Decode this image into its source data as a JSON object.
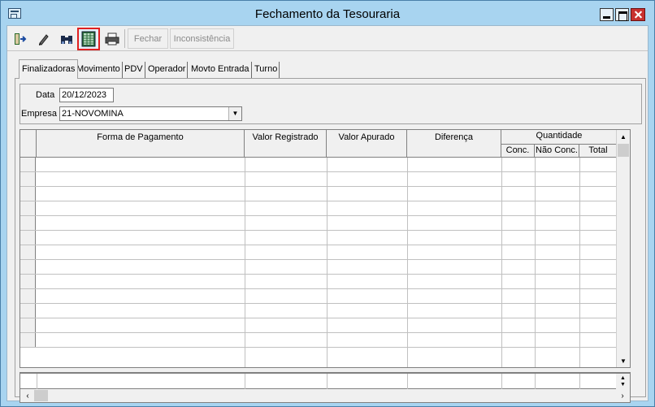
{
  "window": {
    "title": "Fechamento da Tesouraria"
  },
  "toolbar": {
    "buttons": [
      {
        "name": "exit-icon"
      },
      {
        "name": "pencil-icon"
      },
      {
        "name": "binoculars-icon"
      },
      {
        "name": "spreadsheet-icon",
        "selected": true
      },
      {
        "name": "printer-icon"
      }
    ],
    "fechar_label": "Fechar",
    "inconsistencia_label": "Inconsistência"
  },
  "tabs": [
    {
      "label": "Finalizadoras",
      "active": true
    },
    {
      "label": "Movimento"
    },
    {
      "label": "PDV"
    },
    {
      "label": "Operador"
    },
    {
      "label": "Movto Entrada"
    },
    {
      "label": "Turno"
    }
  ],
  "filters": {
    "data_label": "Data",
    "data_value": "20/12/2023",
    "empresa_label": "Empresa",
    "empresa_value": "21-NOVOMINA"
  },
  "grid": {
    "columns": {
      "forma": "Forma de Pagamento",
      "registrado": "Valor Registrado",
      "apurado": "Valor Apurado",
      "diferenca": "Diferença",
      "quantidade": "Quantidade",
      "conc": "Conc.",
      "nao_conc": "Não Conc.",
      "total": "Total"
    },
    "row_count": 13
  },
  "colors": {
    "title_bg": "#a8d4f0",
    "selected_outline": "#e02020",
    "close_button": "#c8312f"
  }
}
